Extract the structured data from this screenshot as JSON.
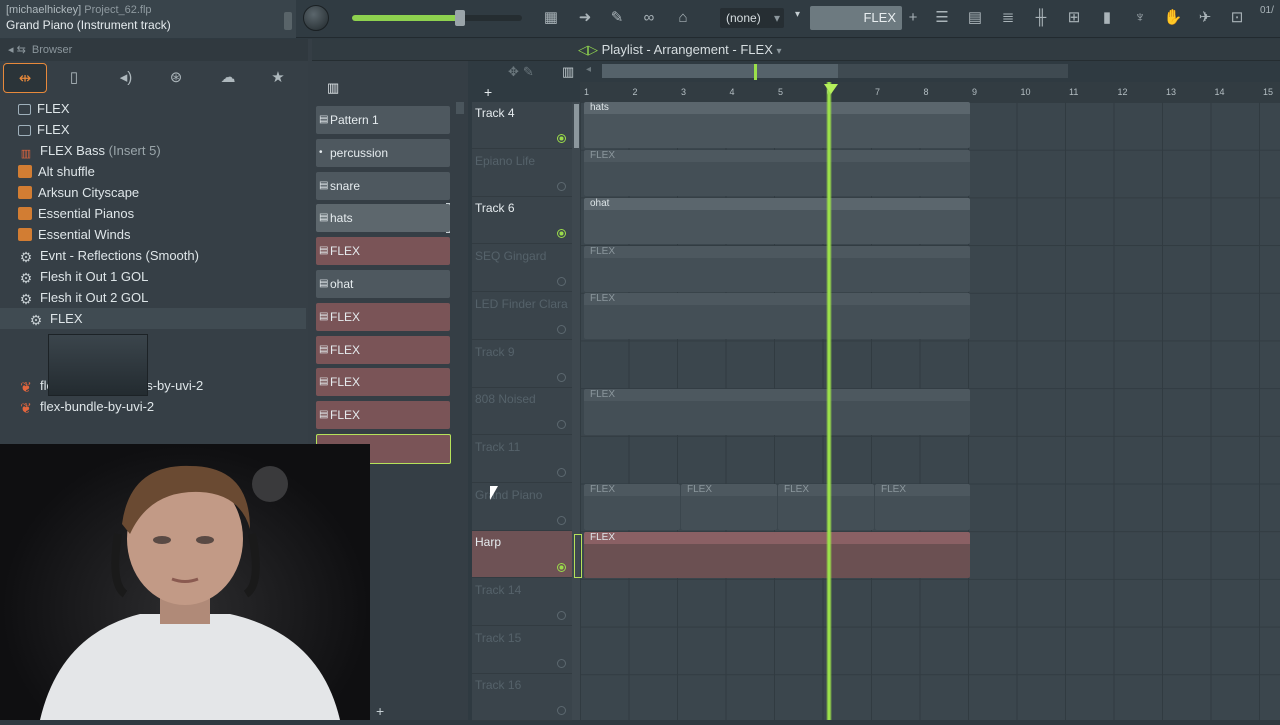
{
  "topbar": {
    "hint_user": "[michaelhickey]",
    "hint_project": "Project_62.flp",
    "hint_line2": "Grand Piano (Instrument track)",
    "pattern_selector": "(none)",
    "flex_label": "FLEX",
    "clock": "01/"
  },
  "browser": {
    "title": "Browser",
    "items": [
      {
        "icon": "folder-icon",
        "label": "FLEX",
        "sub": ""
      },
      {
        "icon": "folder-icon",
        "label": "FLEX",
        "sub": ""
      },
      {
        "icon": "mixer-insert-icon",
        "label": "FLEX Bass",
        "sub": "(Insert 5)"
      },
      {
        "icon": "preset-icon",
        "label": "Alt shuffle",
        "sub": ""
      },
      {
        "icon": "preset-icon",
        "label": "Arksun Cityscape",
        "sub": ""
      },
      {
        "icon": "preset-icon",
        "label": "Essential Pianos",
        "sub": ""
      },
      {
        "icon": "preset-icon",
        "label": "Essential Winds",
        "sub": ""
      },
      {
        "icon": "plugin-gear-icon",
        "label": "Evnt - Reflections (Smooth)",
        "sub": ""
      },
      {
        "icon": "plugin-gear-icon",
        "label": "Flesh it Out 1 GOL",
        "sub": ""
      },
      {
        "icon": "plugin-gear-icon",
        "label": "Flesh it Out 2 GOL",
        "sub": ""
      },
      {
        "icon": "plugin-gear-icon",
        "label": "FLEX",
        "sub": ""
      },
      {
        "icon": "uvi-icon",
        "label": "flex-acoustic-drums-by-uvi-2",
        "sub": ""
      },
      {
        "icon": "uvi-icon",
        "label": "flex-bundle-by-uvi-2",
        "sub": ""
      }
    ]
  },
  "patterns": [
    {
      "label": "Pattern 1",
      "style": "grey"
    },
    {
      "label": "percussion",
      "style": "grey"
    },
    {
      "label": "snare",
      "style": "grey"
    },
    {
      "label": "hats",
      "style": "sel"
    },
    {
      "label": "FLEX",
      "style": "red"
    },
    {
      "label": "ohat",
      "style": "grey"
    },
    {
      "label": "FLEX",
      "style": "red"
    },
    {
      "label": "FLEX",
      "style": "red"
    },
    {
      "label": "FLEX",
      "style": "red"
    },
    {
      "label": "FLEX",
      "style": "red"
    }
  ],
  "playlist": {
    "title": "Playlist - Arrangement",
    "pattern_name": "FLEX",
    "ruler": [
      "1",
      "2",
      "3",
      "4",
      "5",
      "6",
      "7",
      "8",
      "9",
      "10",
      "11",
      "12",
      "13",
      "14",
      "15"
    ],
    "tracks": [
      {
        "name": "Track 4",
        "active": true
      },
      {
        "name": "Epiano Life",
        "active": false
      },
      {
        "name": "Track 6",
        "active": true
      },
      {
        "name": "SEQ Gingard",
        "active": false
      },
      {
        "name": "LED Finder Clara",
        "active": false
      },
      {
        "name": "Track 9",
        "active": false
      },
      {
        "name": "808 Noised",
        "active": false
      },
      {
        "name": "Track 11",
        "active": false
      },
      {
        "name": "Grand Piano",
        "active": false
      },
      {
        "name": "Harp",
        "active": true
      },
      {
        "name": "Track 14",
        "active": false
      },
      {
        "name": "Track 15",
        "active": false
      },
      {
        "name": "Track 16",
        "active": false
      }
    ],
    "clips": {
      "hats": "hats",
      "ohat": "ohat",
      "flex": "FLEX"
    }
  }
}
